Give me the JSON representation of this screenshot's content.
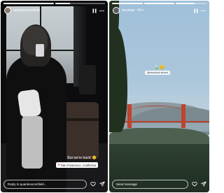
{
  "stories": [
    {
      "username": "quanknocomfield",
      "progress": [
        1,
        0.3
      ],
      "caption": "But we're back!",
      "caption_emoji": "😊",
      "location": "San Francisco, California",
      "reply_placeholder": "Reply to quanknocomfield..."
    },
    {
      "username": "mourrgo",
      "timestamp": "49m",
      "progress": [
        1,
        1,
        0.6
      ],
      "emojis": "🍃😊",
      "mention": "@mesolodo.sirvent",
      "reply_placeholder": "Send message"
    }
  ],
  "icons": {
    "pause": "pause-icon",
    "more": "more-options-icon",
    "heart": "heart-icon",
    "send": "send-icon"
  },
  "colors": {
    "background": "#ffffff",
    "story_dark": "#0c0c0e",
    "bridge": "#c0442e"
  }
}
